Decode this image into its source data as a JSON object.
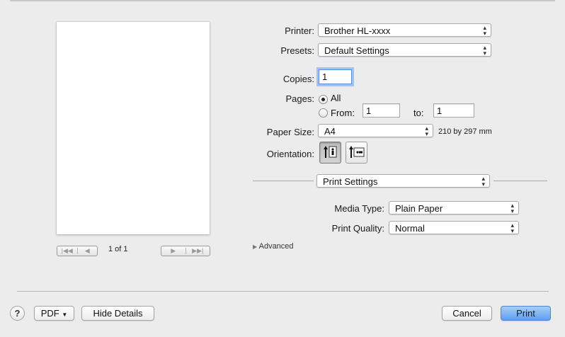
{
  "preview": {
    "page_count": "1 of 1",
    "nav_first": "|◀◀",
    "nav_prev": "◀",
    "nav_next": "▶",
    "nav_last": "▶▶|"
  },
  "printer": {
    "label": "Printer:",
    "value": "Brother HL-xxxx"
  },
  "presets": {
    "label": "Presets:",
    "value": "Default Settings"
  },
  "copies": {
    "label": "Copies:",
    "value": "1"
  },
  "pages": {
    "label": "Pages:",
    "all_label": "All",
    "all_selected": true,
    "from_label": "From:",
    "from_value": "1",
    "to_label": "to:",
    "to_value": "1"
  },
  "paper_size": {
    "label": "Paper Size:",
    "value": "A4",
    "dimensions": "210 by 297 mm"
  },
  "orientation": {
    "label": "Orientation:",
    "selected": "portrait"
  },
  "panel": {
    "value": "Print Settings"
  },
  "media_type": {
    "label": "Media Type:",
    "value": "Plain Paper"
  },
  "print_quality": {
    "label": "Print Quality:",
    "value": "Normal"
  },
  "advanced": {
    "label": "Advanced"
  },
  "footer": {
    "help": "?",
    "pdf_label": "PDF",
    "hide_details_label": "Hide Details",
    "cancel_label": "Cancel",
    "print_label": "Print"
  },
  "colors": {
    "accent": "#5f9ff0",
    "background": "#ececec"
  }
}
